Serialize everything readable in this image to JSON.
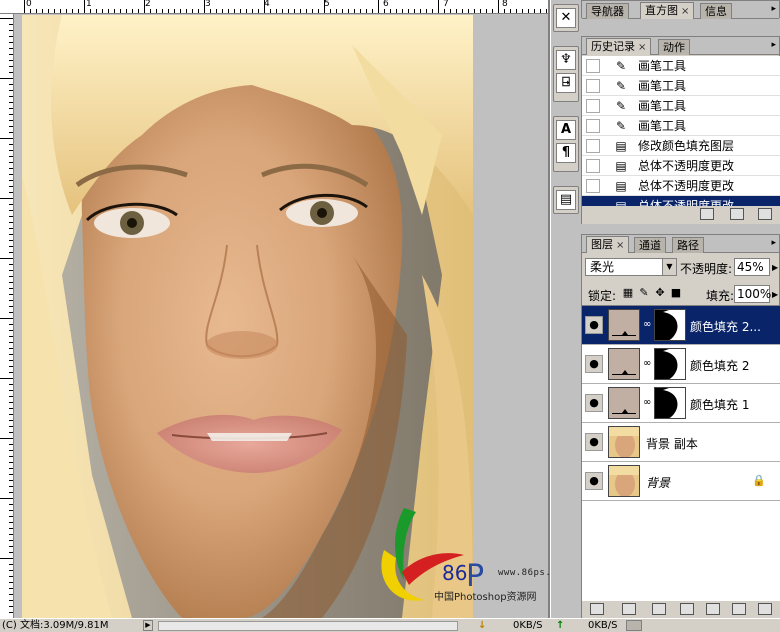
{
  "rulers": {
    "top_labels": [
      "0",
      "1",
      "2",
      "3",
      "4",
      "5",
      "6",
      "7",
      "8"
    ]
  },
  "watermark": {
    "logo_text": "86",
    "logo_p": "P",
    "site": "www.86ps.com",
    "caption": "中国Photoshop资源网"
  },
  "status": {
    "doc_info": "(C) 文档:3.09M/9.81M",
    "download_1": "0KB/S",
    "download_2": "0KB/S",
    "arrow_glyph": "▶",
    "down_glyph": "↓",
    "up_glyph": "↑"
  },
  "tools": {
    "group1": [
      "✕"
    ],
    "group2": [
      "♆",
      "⍈"
    ],
    "group3": [
      "A",
      "¶"
    ],
    "group4": [
      "▤"
    ]
  },
  "navigator_panel": {
    "tabs": [
      "导航器",
      "直方图",
      "信息"
    ],
    "close_glyph": "×",
    "menu_glyph": "▸"
  },
  "history_panel": {
    "tabs": [
      "历史记录",
      "动作"
    ],
    "close_glyph": "×",
    "menu_glyph": "▸",
    "items": [
      {
        "icon": "brush-icon",
        "glyph": "✎",
        "label": "画笔工具"
      },
      {
        "icon": "brush-icon",
        "glyph": "✎",
        "label": "画笔工具"
      },
      {
        "icon": "brush-icon",
        "glyph": "✎",
        "label": "画笔工具"
      },
      {
        "icon": "brush-icon",
        "glyph": "✎",
        "label": "画笔工具"
      },
      {
        "icon": "document-icon",
        "glyph": "▤",
        "label": "修改颜色填充图层"
      },
      {
        "icon": "document-icon",
        "glyph": "▤",
        "label": "总体不透明度更改"
      },
      {
        "icon": "document-icon",
        "glyph": "▤",
        "label": "总体不透明度更改"
      },
      {
        "icon": "document-icon",
        "glyph": "▤",
        "label": "总体不透明度更改"
      }
    ],
    "selected_index": 7
  },
  "layers_panel": {
    "tabs": [
      "图层",
      "通道",
      "路径"
    ],
    "close_glyph": "×",
    "menu_glyph": "▸",
    "blend_mode": "柔光",
    "opacity_label": "不透明度:",
    "opacity_value": "45%",
    "lock_label": "锁定:",
    "fill_label": "填充:",
    "fill_value": "100%",
    "eye_glyph": "●",
    "chain_glyph": "∞",
    "padlock_glyph": "🔒",
    "layers": [
      {
        "name": "颜色填充 2...",
        "type": "fill",
        "selected": true
      },
      {
        "name": "颜色填充 2",
        "type": "fill",
        "selected": false
      },
      {
        "name": "颜色填充 1",
        "type": "fill",
        "selected": false
      },
      {
        "name": "背景 副本",
        "type": "photo",
        "selected": false
      },
      {
        "name": "背景",
        "type": "photo-locked",
        "selected": false
      }
    ],
    "colors": {
      "fill_swatch": "#c2afa4",
      "selection": "#0a246a"
    }
  }
}
